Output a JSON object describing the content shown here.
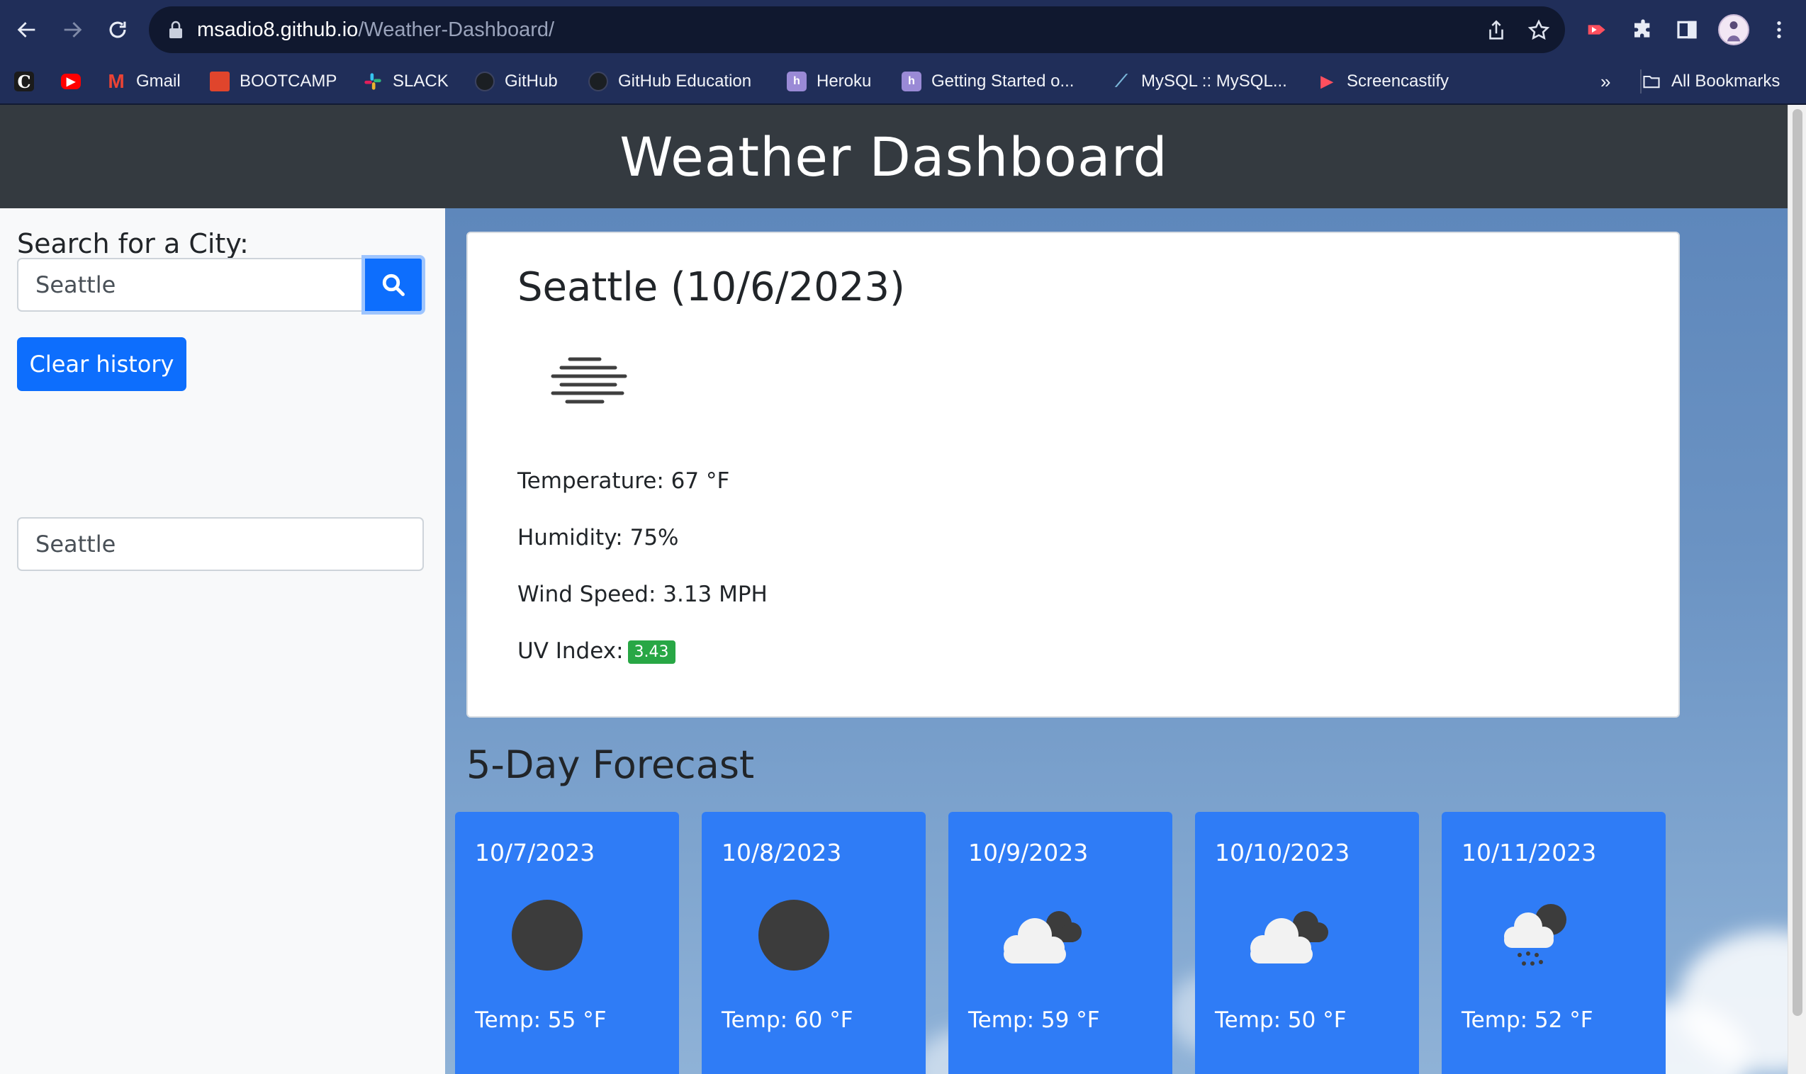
{
  "browser": {
    "url_host": "msadio8.github.io",
    "url_path": "/Weather-Dashboard/",
    "bookmarks": [
      {
        "label": "",
        "icon": "c-icon"
      },
      {
        "label": "",
        "icon": "youtube-icon"
      },
      {
        "label": "Gmail",
        "icon": "gmail-icon"
      },
      {
        "label": "BOOTCAMP",
        "icon": "bootcamp-icon"
      },
      {
        "label": "SLACK",
        "icon": "slack-icon"
      },
      {
        "label": "GitHub",
        "icon": "github-icon"
      },
      {
        "label": "GitHub Education",
        "icon": "github-icon"
      },
      {
        "label": "Heroku",
        "icon": "heroku-icon"
      },
      {
        "label": "Getting Started o...",
        "icon": "heroku-icon"
      },
      {
        "label": "MySQL :: MySQL...",
        "icon": "mysql-icon"
      },
      {
        "label": "Screencastify",
        "icon": "screencastify-icon"
      }
    ],
    "overflow_label": "»",
    "all_bookmarks_label": "All Bookmarks"
  },
  "header": {
    "title": "Weather Dashboard"
  },
  "sidebar": {
    "search_label": "Search for a City:",
    "search_value": "Seattle",
    "clear_label": "Clear history",
    "history": [
      "Seattle"
    ]
  },
  "current": {
    "city_date": "Seattle (10/6/2023)",
    "icon": "mist-icon",
    "temperature": "Temperature: 67 °F",
    "humidity": "Humidity: 75%",
    "wind": "Wind Speed: 3.13 MPH",
    "uv_label": "UV Index:",
    "uv_value": "3.43",
    "uv_color": "#28a745"
  },
  "forecast": {
    "title": "5-Day Forecast",
    "days": [
      {
        "date": "10/7/2023",
        "icon": "clear-night-icon",
        "temp": "Temp: 55 °F"
      },
      {
        "date": "10/8/2023",
        "icon": "clear-night-icon",
        "temp": "Temp: 60 °F"
      },
      {
        "date": "10/9/2023",
        "icon": "broken-clouds-icon",
        "temp": "Temp: 59 °F"
      },
      {
        "date": "10/10/2023",
        "icon": "broken-clouds-icon",
        "temp": "Temp: 50 °F"
      },
      {
        "date": "10/11/2023",
        "icon": "rain-icon",
        "temp": "Temp: 52 °F"
      }
    ]
  },
  "colors": {
    "header_bg": "#343a40",
    "primary": "#0d6efd",
    "forecast_card": "#2f7cf6",
    "browser_chrome": "#202e59"
  }
}
